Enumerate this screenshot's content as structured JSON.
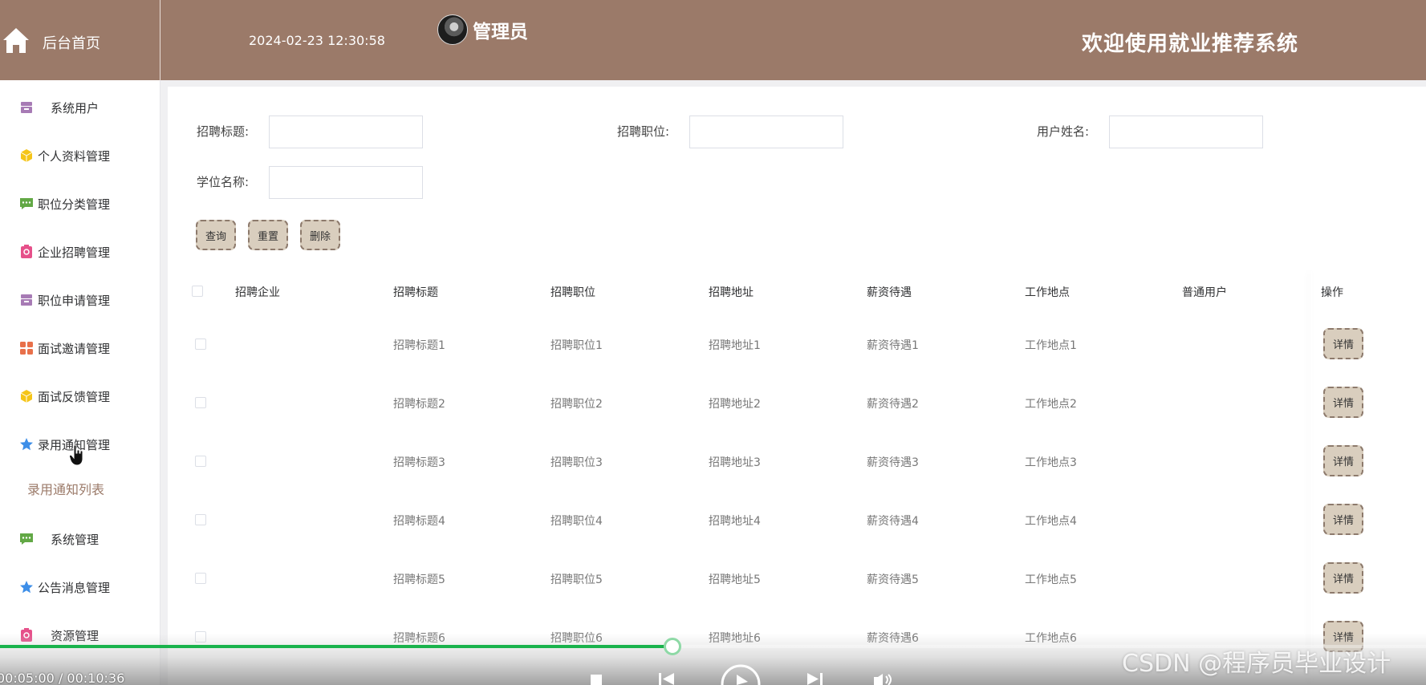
{
  "header": {
    "home_label": "后台首页",
    "datetime": "2024-02-23 12:30:58",
    "user_name": "管理员",
    "welcome": "欢迎使用就业推荐系统",
    "bg_color": "#9b7a69"
  },
  "sidebar": {
    "items": [
      {
        "label": "系统用户",
        "icon": "archive-icon",
        "color": "#a77bb5"
      },
      {
        "label": "个人资料管理",
        "icon": "cube-icon",
        "color": "#f5c518"
      },
      {
        "label": "职位分类管理",
        "icon": "chat-icon",
        "color": "#62a845"
      },
      {
        "label": "企业招聘管理",
        "icon": "badge-icon",
        "color": "#e6508a"
      },
      {
        "label": "职位申请管理",
        "icon": "archive-icon",
        "color": "#a77bb5"
      },
      {
        "label": "面试邀请管理",
        "icon": "grid-icon",
        "color": "#e8704a"
      },
      {
        "label": "面试反馈管理",
        "icon": "cube-icon",
        "color": "#f5c518"
      },
      {
        "label": "录用通知管理",
        "icon": "star-icon",
        "color": "#3d8ee8"
      },
      {
        "label": "系统管理",
        "icon": "chat-icon",
        "color": "#62a845"
      },
      {
        "label": "公告消息管理",
        "icon": "star-icon",
        "color": "#3d8ee8"
      },
      {
        "label": "资源管理",
        "icon": "badge-icon",
        "color": "#e6508a"
      }
    ],
    "submenu_label": "录用通知列表"
  },
  "filters": {
    "title_label": "招聘标题:",
    "position_label": "招聘职位:",
    "username_label": "用户姓名:",
    "degree_label": "学位名称:",
    "title_value": "",
    "position_value": "",
    "username_value": "",
    "degree_value": ""
  },
  "buttons": {
    "query": "查询",
    "reset": "重置",
    "delete": "删除"
  },
  "table": {
    "columns": [
      "招聘企业",
      "招聘标题",
      "招聘职位",
      "招聘地址",
      "薪资待遇",
      "工作地点",
      "普通用户",
      "操作"
    ],
    "detail_label": "详情",
    "rows": [
      {
        "company": "",
        "title": "招聘标题1",
        "position": "招聘职位1",
        "address": "招聘地址1",
        "salary": "薪资待遇1",
        "location": "工作地点1",
        "user": ""
      },
      {
        "company": "",
        "title": "招聘标题2",
        "position": "招聘职位2",
        "address": "招聘地址2",
        "salary": "薪资待遇2",
        "location": "工作地点2",
        "user": ""
      },
      {
        "company": "",
        "title": "招聘标题3",
        "position": "招聘职位3",
        "address": "招聘地址3",
        "salary": "薪资待遇3",
        "location": "工作地点3",
        "user": ""
      },
      {
        "company": "",
        "title": "招聘标题4",
        "position": "招聘职位4",
        "address": "招聘地址4",
        "salary": "薪资待遇4",
        "location": "工作地点4",
        "user": ""
      },
      {
        "company": "",
        "title": "招聘标题5",
        "position": "招聘职位5",
        "address": "招聘地址5",
        "salary": "薪资待遇5",
        "location": "工作地点5",
        "user": ""
      },
      {
        "company": "",
        "title": "招聘标题6",
        "position": "招聘职位6",
        "address": "招聘地址6",
        "salary": "薪资待遇6",
        "location": "工作地点6",
        "user": ""
      }
    ]
  },
  "player": {
    "time": "00:05:00 / 00:10:36",
    "progress": 0.4717,
    "watermark": "CSDN @程序员毕业设计",
    "accent_color": "#1ab34c"
  }
}
